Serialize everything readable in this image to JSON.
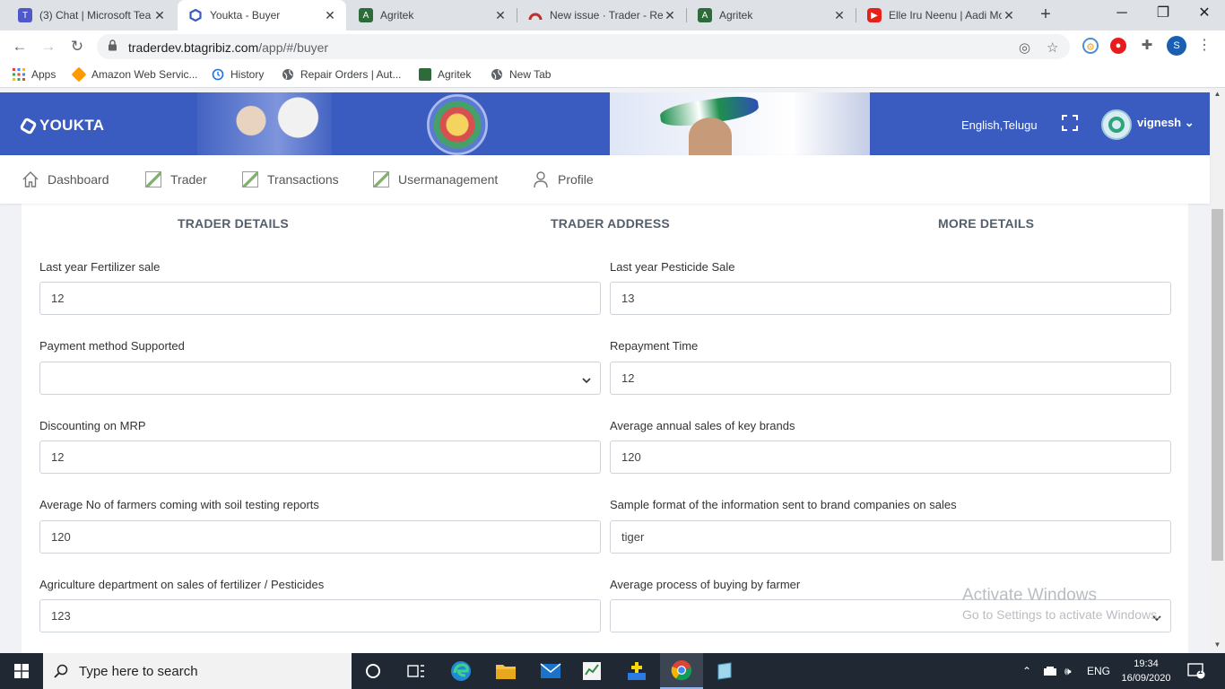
{
  "browser": {
    "tabs": [
      {
        "title": "(3) Chat | Microsoft Tea",
        "icon": "teams-icon",
        "color": "#5059c9"
      },
      {
        "title": "Youkta - Buyer",
        "icon": "youkta-icon",
        "color": "#3a5bbf"
      },
      {
        "title": "Agritek",
        "icon": "agritek-icon",
        "color": "#2d6b3a"
      },
      {
        "title": "New issue · Trader - Re",
        "icon": "redmine-icon",
        "color": "#c42b2b"
      },
      {
        "title": "Agritek",
        "icon": "agritek-icon",
        "color": "#2d6b3a"
      },
      {
        "title": "Elle Iru Neenu | Aadi Mo",
        "icon": "youtube-icon",
        "color": "#e62117"
      }
    ],
    "url_host": "traderdev.btagribiz.com",
    "url_path": "/app/#/buyer",
    "profile_initial": "S",
    "bookmarks": [
      {
        "label": "Apps",
        "icon": "apps-grid-icon"
      },
      {
        "label": "Amazon Web Servic...",
        "icon": "aws-icon"
      },
      {
        "label": "History",
        "icon": "history-icon"
      },
      {
        "label": "Repair Orders | Aut...",
        "icon": "globe-icon"
      },
      {
        "label": "Agritek",
        "icon": "agritek-icon"
      },
      {
        "label": "New Tab",
        "icon": "globe-icon"
      }
    ]
  },
  "app": {
    "brand": "YOUKTA",
    "language": "English,Telugu",
    "username": "vignesh",
    "menu": [
      {
        "label": "Dashboard",
        "icon": "home-icon"
      },
      {
        "label": "Trader",
        "icon": "broken-image-icon"
      },
      {
        "label": "Transactions",
        "icon": "broken-image-icon"
      },
      {
        "label": "Usermanagement",
        "icon": "broken-image-icon"
      },
      {
        "label": "Profile",
        "icon": "user-icon"
      }
    ]
  },
  "steps": [
    "TRADER DETAILS",
    "TRADER ADDRESS",
    "MORE DETAILS"
  ],
  "form": {
    "fertilizer_label": "Last year Fertilizer sale",
    "fertilizer_value": "12",
    "pesticide_label": "Last year Pesticide Sale",
    "pesticide_value": "13",
    "payment_label": "Payment method Supported",
    "payment_value": "",
    "repayment_label": "Repayment Time",
    "repayment_value": "12",
    "discount_label": "Discounting on MRP",
    "discount_value": "12",
    "brands_label": "Average annual sales of key brands",
    "brands_value": "120",
    "farmers_label": "Average No of farmers coming with soil testing reports",
    "farmers_value": "120",
    "sample_label": "Sample format of the information sent to brand companies on sales",
    "sample_value": "tiger",
    "agri_label": "Agriculture department on sales of fertilizer / Pesticides",
    "agri_value": "123",
    "buying_label": "Average process of buying by farmer",
    "buying_value": ""
  },
  "watermark": {
    "title": "Activate Windows",
    "subtitle": "Go to Settings to activate Windows."
  },
  "taskbar": {
    "search_placeholder": "Type here to search",
    "language": "ENG",
    "time": "19:34",
    "date": "16/09/2020",
    "notification_count": "1"
  },
  "colors": {
    "header_blue": "#3a5bbf",
    "step_green": "#3ba55c",
    "step_blue": "#4c63d2"
  }
}
